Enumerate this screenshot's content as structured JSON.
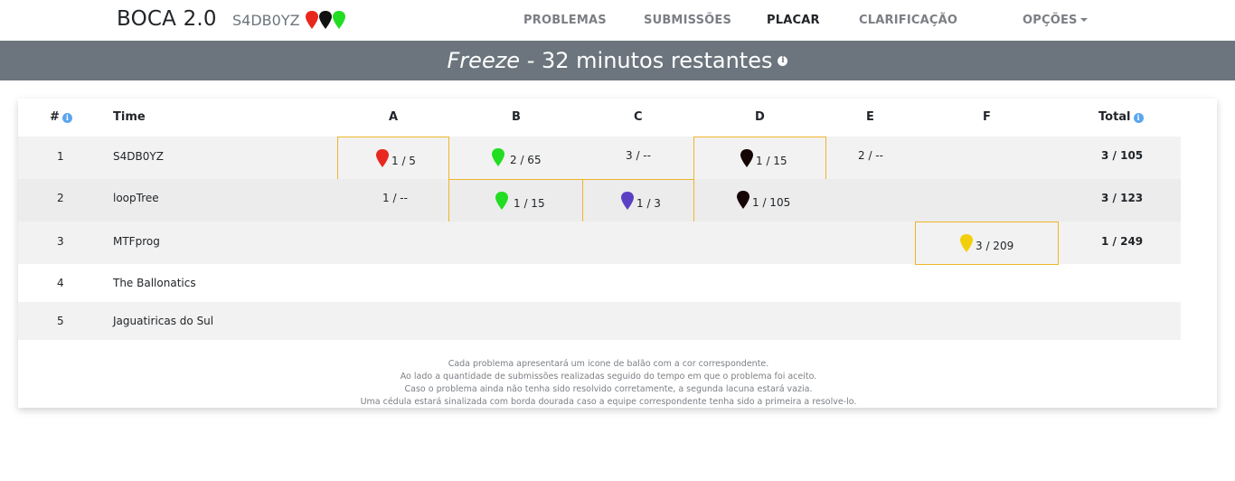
{
  "navbar": {
    "brand": "BOCA 2.0",
    "team": "S4DB0YZ",
    "team_balloons": [
      "#e8281e",
      "#111111",
      "#22dd22"
    ],
    "links": [
      "PROBLEMAS",
      "SUBMISSÕES",
      "PLACAR",
      "CLARIFICAÇÃO",
      "OPÇÕES"
    ],
    "active": "PLACAR"
  },
  "banner": {
    "freeze_label": "Freeze",
    "remaining": " - 32 minutos restantes"
  },
  "table": {
    "headers": {
      "rank": "#",
      "team": "Time",
      "problems": [
        "A",
        "B",
        "C",
        "D",
        "E",
        "F"
      ],
      "total": "Total"
    },
    "rows": [
      {
        "rank": "1",
        "team": "S4DB0YZ",
        "cells": {
          "A": "1 / 5",
          "B": "2 / 65",
          "C": "3 / --",
          "D": "1 / 15",
          "E": "2 / --",
          "F": ""
        },
        "total": "3 / 105"
      },
      {
        "rank": "2",
        "team": "loopTree",
        "cells": {
          "A": "1 / --",
          "B": "1 / 15",
          "C": "1 / 3",
          "D": "1 / 105",
          "E": "",
          "F": ""
        },
        "total": "3 / 123"
      },
      {
        "rank": "3",
        "team": "MTFprog",
        "cells": {
          "A": "",
          "B": "",
          "C": "",
          "D": "",
          "E": "",
          "F": "3 / 209"
        },
        "total": "1 / 249"
      },
      {
        "rank": "4",
        "team": "The Ballonatics",
        "cells": {
          "A": "",
          "B": "",
          "C": "",
          "D": "",
          "E": "",
          "F": ""
        },
        "total": ""
      },
      {
        "rank": "5",
        "team": "Jaguatiricas do Sul",
        "cells": {
          "A": "",
          "B": "",
          "C": "",
          "D": "",
          "E": "",
          "F": ""
        },
        "total": ""
      }
    ]
  },
  "balloon_colors": {
    "A": "#e8281e",
    "B": "#22dd22",
    "C": "#5b3fc4",
    "D": "#150505",
    "F": "#f2cf0a"
  },
  "footnote": [
    "Cada problema apresentará um icone de balão com a cor correspondente.",
    "Ao lado a quantidade de submissões realizadas seguido do tempo em que o problema foi aceito.",
    "Caso o problema ainda não tenha sido resolvido corretamente, a segunda lacuna estará vazia.",
    "Uma cédula estará sinalizada com borda dourada caso a equipe correspondente tenha sido a primeira a resolve-lo."
  ]
}
